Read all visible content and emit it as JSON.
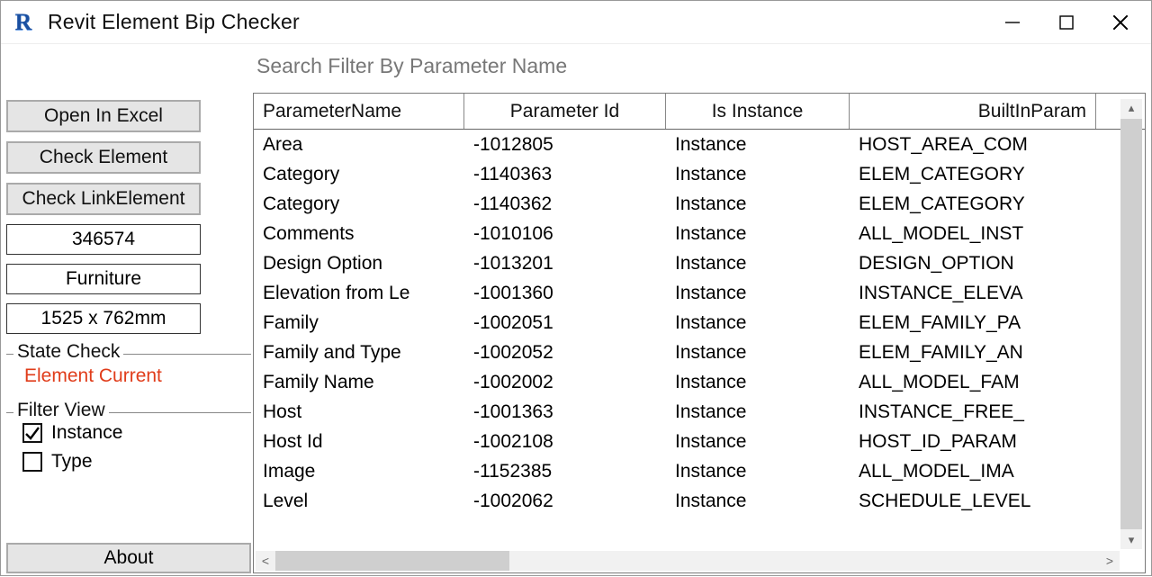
{
  "window": {
    "title": "Revit Element Bip Checker"
  },
  "search": {
    "placeholder": "Search Filter By Parameter Name"
  },
  "sidebar": {
    "open_excel": "Open In Excel",
    "check_element": "Check Element",
    "check_link": "Check LinkElement",
    "element_id": "346574",
    "category": "Furniture",
    "family_type": "1525 x 762mm",
    "state_legend": "State Check",
    "state_value": "Element Current",
    "filter_legend": "Filter View",
    "filter_instance_label": "Instance",
    "filter_instance_checked": true,
    "filter_type_label": "Type",
    "filter_type_checked": false,
    "about": "About"
  },
  "grid": {
    "columns": [
      "ParameterName",
      "Parameter Id",
      "Is Instance",
      "BuiltInParam"
    ],
    "rows": [
      {
        "name": "Area",
        "id": "-1012805",
        "inst": "Instance",
        "bip": "HOST_AREA_COM"
      },
      {
        "name": "Category",
        "id": "-1140363",
        "inst": "Instance",
        "bip": "ELEM_CATEGORY"
      },
      {
        "name": "Category",
        "id": "-1140362",
        "inst": "Instance",
        "bip": "ELEM_CATEGORY"
      },
      {
        "name": "Comments",
        "id": "-1010106",
        "inst": "Instance",
        "bip": "ALL_MODEL_INST"
      },
      {
        "name": "Design Option",
        "id": "-1013201",
        "inst": "Instance",
        "bip": "DESIGN_OPTION"
      },
      {
        "name": "Elevation from Le",
        "id": "-1001360",
        "inst": "Instance",
        "bip": "INSTANCE_ELEVA"
      },
      {
        "name": "Family",
        "id": "-1002051",
        "inst": "Instance",
        "bip": "ELEM_FAMILY_PA"
      },
      {
        "name": "Family and Type",
        "id": "-1002052",
        "inst": "Instance",
        "bip": "ELEM_FAMILY_AN"
      },
      {
        "name": "Family Name",
        "id": "-1002002",
        "inst": "Instance",
        "bip": "ALL_MODEL_FAM"
      },
      {
        "name": "Host",
        "id": "-1001363",
        "inst": "Instance",
        "bip": "INSTANCE_FREE_"
      },
      {
        "name": "Host Id",
        "id": "-1002108",
        "inst": "Instance",
        "bip": "HOST_ID_PARAM"
      },
      {
        "name": "Image",
        "id": "-1152385",
        "inst": "Instance",
        "bip": "ALL_MODEL_IMA"
      },
      {
        "name": "Level",
        "id": "-1002062",
        "inst": "Instance",
        "bip": "SCHEDULE_LEVEL"
      }
    ]
  }
}
